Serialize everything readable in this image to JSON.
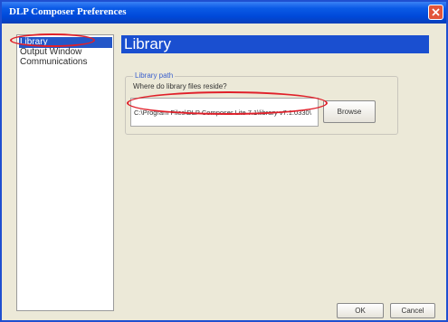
{
  "window": {
    "title": "DLP Composer Preferences"
  },
  "nav": {
    "items": [
      {
        "label": "Library",
        "selected": true
      },
      {
        "label": "Output Window",
        "selected": false
      },
      {
        "label": "Communications",
        "selected": false
      }
    ]
  },
  "panel": {
    "title": "Library"
  },
  "library_path": {
    "group_label": "Library path",
    "prompt": "Where do library files reside?",
    "value": "C:\\Program Files\\DLP Composer Lite 7.1\\library v7.1.0330\\",
    "browse_label": "Browse"
  },
  "footer": {
    "ok_label": "OK",
    "cancel_label": "Cancel"
  },
  "colors": {
    "titlebar": "#0048d8",
    "panel_header": "#1a4fd0",
    "selection": "#2457c8",
    "annotation": "#e0202a",
    "close_button": "#e2553a"
  },
  "icons": {
    "close": "close-icon"
  }
}
